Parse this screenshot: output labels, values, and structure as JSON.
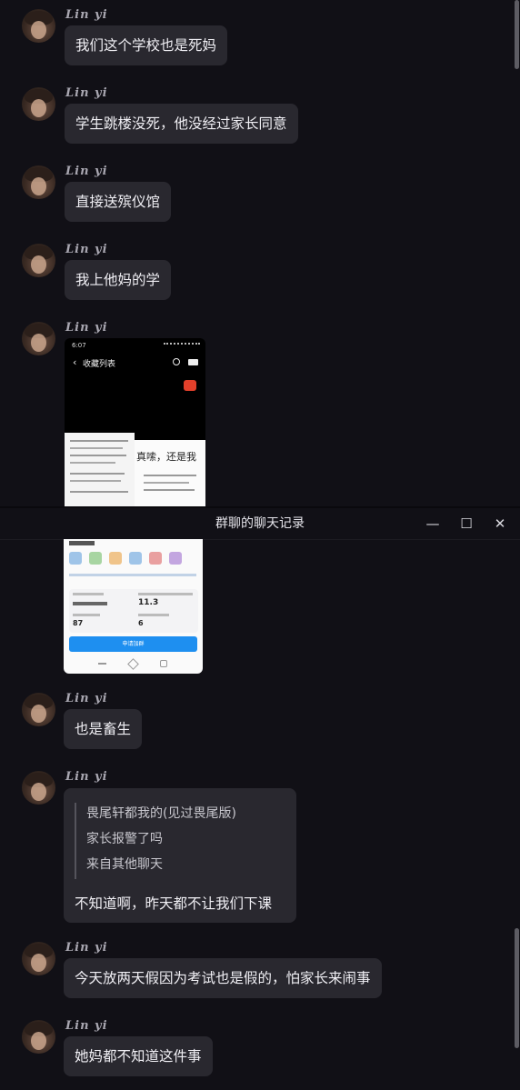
{
  "sender_name": "Lin yi",
  "window_title": "群聊的聊天记录",
  "window_controls": {
    "minimize": "—",
    "maximize": "☐",
    "close": "✕"
  },
  "top_messages": [
    "我们这个学校也是死妈",
    "学生跳楼没死，他没经过家长同意",
    "直接送殡仪馆",
    "我上他妈的学"
  ],
  "shared_screenshot": {
    "status_time": "6:07",
    "header": "收藏列表",
    "caption_snippet": "真嗦，还是我",
    "stat_value": "11.3",
    "stat_value_2": "87",
    "stat_value_3": "6",
    "button_text": "申请加群"
  },
  "bottom_messages": {
    "m1": "也是畜生",
    "quote": {
      "lines": [
        "畏尾轩都我的(见过畏尾版)",
        "家长报警了吗",
        "来自其他聊天"
      ],
      "reply": "不知道啊，昨天都不让我们下课"
    },
    "m3": "今天放两天假因为考试也是假的，怕家长来闹事",
    "m4": "她妈都不知道这件事"
  }
}
